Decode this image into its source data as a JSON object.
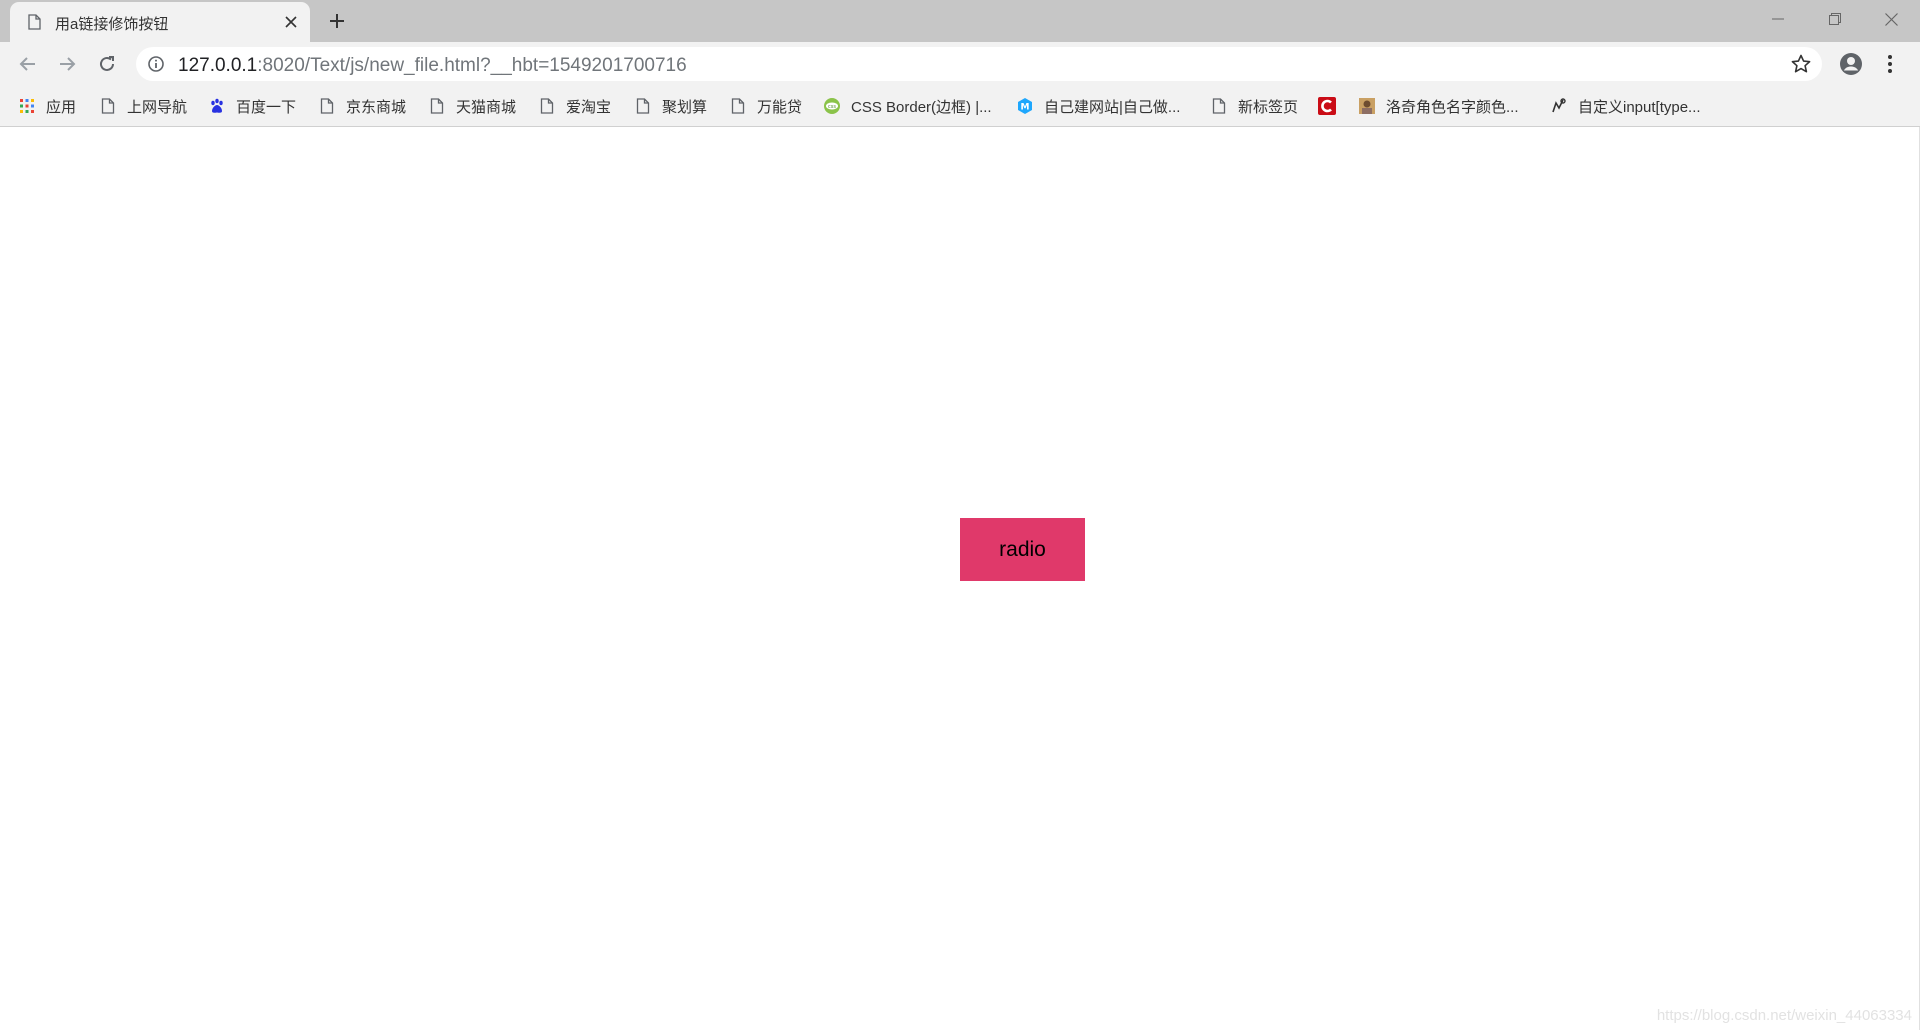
{
  "tab": {
    "title": "用a链接修饰按钮",
    "favicon": "page-icon",
    "close_icon": "close-icon",
    "new_tab_icon": "plus-icon"
  },
  "window_controls": [
    "minimize-icon",
    "restore-icon",
    "close-icon"
  ],
  "toolbar": {
    "back_icon": "back-arrow-icon",
    "forward_icon": "forward-arrow-icon",
    "reload_icon": "reload-icon",
    "url_host": "127.0.0.1",
    "url_rest": ":8020/Text/js/new_file.html?__hbt=1549201700716",
    "bookmark_star_icon": "star-icon",
    "profile_icon": "account-icon",
    "menu_icon": "more-vert-icon"
  },
  "bookmarks": [
    {
      "label": "应用",
      "icon": "apps-grid-icon"
    },
    {
      "label": "上网导航",
      "icon": "page-icon"
    },
    {
      "label": "百度一下",
      "icon": "baidu-paw-icon"
    },
    {
      "label": "京东商城",
      "icon": "page-icon"
    },
    {
      "label": "天猫商城",
      "icon": "page-icon"
    },
    {
      "label": "爱淘宝",
      "icon": "page-icon"
    },
    {
      "label": "聚划算",
      "icon": "page-icon"
    },
    {
      "label": "万能贷",
      "icon": "page-icon"
    },
    {
      "label": "CSS Border(边框) |...",
      "icon": "globe-green-icon"
    },
    {
      "label": "自己建网站|自己做...",
      "icon": "m-logo-icon"
    },
    {
      "label": "新标签页",
      "icon": "page-icon"
    },
    {
      "label": "",
      "icon": "csdn-c-icon"
    },
    {
      "label": "洛奇角色名字颜色...",
      "icon": "character-icon"
    },
    {
      "label": "自定义input[type...",
      "icon": "pen-icon"
    }
  ],
  "page": {
    "button_label": "radio",
    "button_color": "#e0396a",
    "watermark": "https://blog.csdn.net/weixin_44063334"
  }
}
